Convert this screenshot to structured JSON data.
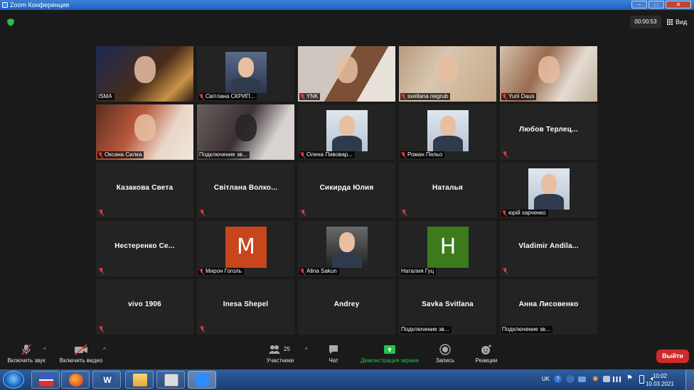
{
  "window": {
    "title": "Zoom Конференция"
  },
  "header": {
    "timer": "00:00:53",
    "view_label": "Вид"
  },
  "participants": [
    {
      "name": "ISMA",
      "kind": "video",
      "muted": false,
      "active": true
    },
    {
      "name": "Світлана СКРИП...",
      "kind": "photo",
      "muted": true
    },
    {
      "name": "YNK",
      "kind": "video",
      "muted": true
    },
    {
      "name": "svetlana negrub",
      "kind": "video",
      "muted": true
    },
    {
      "name": "Yurii Daus",
      "kind": "video",
      "muted": true
    },
    {
      "name": "Оксана Силка",
      "kind": "video",
      "muted": true
    },
    {
      "name": "Подключение зв...",
      "kind": "video",
      "muted": false
    },
    {
      "name": "Олена Пивовар...",
      "kind": "photo",
      "muted": true
    },
    {
      "name": "Роман Пельо",
      "kind": "photo",
      "muted": true
    },
    {
      "name": "Любов Терлец...",
      "kind": "name",
      "muted": true
    },
    {
      "name": "Казакова Света",
      "kind": "name",
      "muted": true
    },
    {
      "name": "Світлана Волко...",
      "kind": "name",
      "muted": true
    },
    {
      "name": "Сикирда Юлия",
      "kind": "name",
      "muted": true
    },
    {
      "name": "Наталья",
      "kind": "name",
      "muted": true
    },
    {
      "name": "юрій харченко",
      "kind": "photo",
      "muted": true
    },
    {
      "name": "Нестеренко Се...",
      "kind": "name",
      "muted": true
    },
    {
      "name": "Мирон Гоголь",
      "kind": "avatar",
      "letter": "M",
      "color": "#c8461b",
      "muted": true
    },
    {
      "name": "Alina Sakun",
      "kind": "photo",
      "muted": true
    },
    {
      "name": "Наталия Гуц",
      "kind": "avatar",
      "letter": "H",
      "color": "#3c7a1e",
      "muted": false
    },
    {
      "name": "Vladimir Andila...",
      "kind": "name",
      "muted": true
    },
    {
      "name": "vivo 1906",
      "kind": "name",
      "muted": true
    },
    {
      "name": "Inesa Shepel",
      "kind": "name",
      "muted": true
    },
    {
      "name": "Andrey",
      "kind": "name",
      "muted": false
    },
    {
      "name": "Savka Svitlana",
      "kind": "name",
      "muted": false,
      "sub": "Подключение зв..."
    },
    {
      "name": "Анна Лисовенко",
      "kind": "name",
      "muted": false,
      "sub": "Подключение зв..."
    }
  ],
  "toolbar": {
    "unmute": "Включить звук",
    "start_video": "Включить видео",
    "participants": "Участники",
    "participants_count": "25",
    "chat": "Чат",
    "share": "Демонстрация экрана",
    "record": "Запись",
    "reactions": "Реакции",
    "leave": "Выйти"
  },
  "taskbar": {
    "lang": "UK",
    "time": "10:02",
    "date": "10.03.2021"
  },
  "colors": {
    "accent_green": "#27c24c",
    "leave_red": "#cc2b2b",
    "active_outline": "#cbe84f",
    "mute_red": "#e23b3b"
  }
}
